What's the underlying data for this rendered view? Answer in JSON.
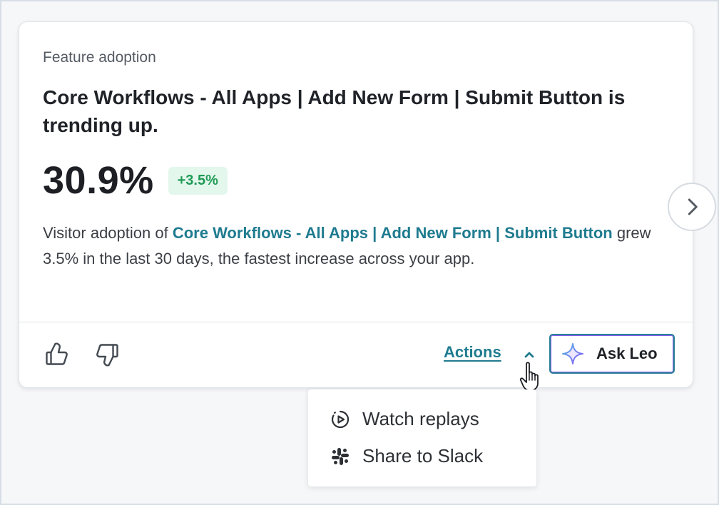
{
  "card": {
    "label": "Feature adoption",
    "title": "Core Workflows - All Apps | Add New Form | Submit Button is trending up.",
    "metric_value": "30.9%",
    "delta_badge": "+3.5%",
    "description": {
      "prefix": "Visitor adoption of ",
      "feature_link": "Core Workflows - All Apps | Add New Form | Submit Button",
      "suffix": " grew 3.5% in the last 30 days, the fastest increase across your app."
    }
  },
  "footer": {
    "actions_label": "Actions",
    "ask_label": "Ask Leo"
  },
  "dropdown": {
    "items": [
      {
        "label": "Watch replays",
        "icon": "replay-icon"
      },
      {
        "label": "Share to Slack",
        "icon": "slack-icon"
      }
    ]
  },
  "colors": {
    "accent": "#1f7b8f",
    "positive": "#1f9a57",
    "positive_bg": "#e4f7ec",
    "ai_purple": "#8b5cf6"
  }
}
